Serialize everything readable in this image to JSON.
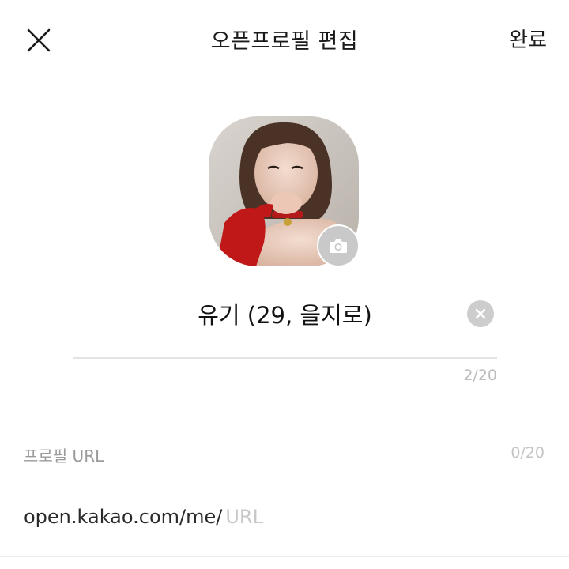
{
  "header": {
    "title": "오픈프로필 편집",
    "done_label": "완료",
    "close_icon": "close-icon"
  },
  "profile": {
    "photo_icon": "profile-photo",
    "camera_icon": "camera-icon"
  },
  "nickname": {
    "value": "유기 (29, 을지로)",
    "count": "2/20",
    "clear_icon": "clear-icon"
  },
  "url": {
    "label": "프로필 URL",
    "count": "0/20",
    "prefix": "open.kakao.com/me/",
    "placeholder": "URL"
  },
  "colors": {
    "background": "#ffffff",
    "text": "#111111",
    "muted": "#9a9a9a",
    "camera_button": "#c9c9c9"
  }
}
